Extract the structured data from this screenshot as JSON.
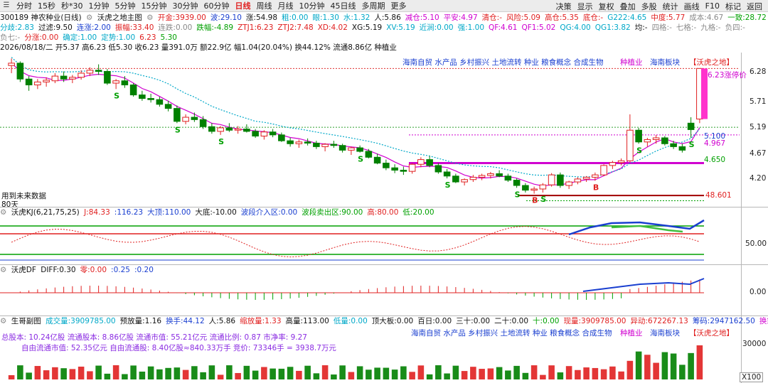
{
  "toolbar": {
    "periods": [
      "分时",
      "15秒",
      "秒*30",
      "1分钟",
      "5分钟",
      "15分钟",
      "30分钟",
      "60分钟",
      "日线",
      "周线",
      "月线",
      "10分钟",
      "45日线",
      "多周期",
      "更多"
    ],
    "right": [
      "决策",
      "显示",
      "复权",
      "叠加",
      "多股",
      "统计",
      "画线",
      "F10",
      "标记",
      "返回"
    ]
  },
  "info_row1": {
    "stock": "300189 神农种业(日线)",
    "indicator": "沃虎之地主图",
    "items": [
      {
        "k": "开金:",
        "v": "3939.00",
        "c": "red"
      },
      {
        "k": "波:",
        "v": "29.10",
        "c": "blue"
      },
      {
        "k": "涨:",
        "v": "54.98",
        "c": "blk"
      },
      {
        "k": "粗:",
        "v": "0.00",
        "c": "cyan"
      },
      {
        "k": "眼:",
        "v": "1.30",
        "c": "cyan"
      },
      {
        "k": "水:",
        "v": "1.32",
        "c": "cyan"
      },
      {
        "k": "人:",
        "v": "5.86",
        "c": "blk"
      },
      {
        "k": "减仓:",
        "v": "5.10",
        "c": "mag"
      },
      {
        "k": "平安:",
        "v": "4.97",
        "c": "mag"
      },
      {
        "k": "清仓:",
        "v": "-",
        "c": "red"
      },
      {
        "k": "风险:",
        "v": "5.09",
        "c": "red"
      },
      {
        "k": "高仓:",
        "v": "5.35",
        "c": "red"
      },
      {
        "k": "底仓:",
        "v": "-",
        "c": "red"
      },
      {
        "k": "G222:",
        "v": "4.65",
        "c": "cyan"
      },
      {
        "k": "中度:",
        "v": "5.77",
        "c": "red"
      },
      {
        "k": "成本:",
        "v": "4.67",
        "c": "gray"
      },
      {
        "k": "一致:",
        "v": "28.72",
        "c": "grn"
      }
    ]
  },
  "info_row2": {
    "items": [
      {
        "k": "分歧:",
        "v": "2.83",
        "c": "cyan"
      },
      {
        "k": "过滤:",
        "v": "9.50",
        "c": "blk"
      },
      {
        "k": "连涨:",
        "v": "2.00",
        "c": "blue"
      },
      {
        "k": "振幅:",
        "v": "33.40",
        "c": "red"
      },
      {
        "k": "连跌:",
        "v": "0.00",
        "c": "gray"
      },
      {
        "k": "跌幅:",
        "v": "-4.89",
        "c": "grn"
      },
      {
        "k": "ZTJ1:",
        "v": "6.23",
        "c": "red"
      },
      {
        "k": "ZTJ2:",
        "v": "7.48",
        "c": "red"
      },
      {
        "k": "XD:",
        "v": "4.02",
        "c": "red"
      },
      {
        "k": "XG:",
        "v": "5.19",
        "c": "blk"
      },
      {
        "k": "XV:",
        "v": "5.19",
        "c": "cyan"
      },
      {
        "k": "近涧:",
        "v": "0.00",
        "c": "cyan"
      },
      {
        "k": "强:",
        "v": "1.00",
        "c": "cyan"
      },
      {
        "k": "QF:",
        "v": "4.61",
        "c": "mag"
      },
      {
        "k": "QF1:",
        "v": "5.02",
        "c": "mag"
      },
      {
        "k": "QG:",
        "v": "4.00",
        "c": "cyan"
      },
      {
        "k": "QG1:",
        "v": "3.82",
        "c": "cyan"
      },
      {
        "k": "均:",
        "v": "-",
        "c": "blk"
      },
      {
        "k": "四格:",
        "v": "-",
        "c": "gray"
      },
      {
        "k": "七格:",
        "v": "-",
        "c": "gray"
      },
      {
        "k": "九格:",
        "v": "-",
        "c": "gray"
      },
      {
        "k": "负四:",
        "v": "-",
        "c": "gray"
      }
    ]
  },
  "info_row3": {
    "items": [
      {
        "k": "负七:",
        "v": "-",
        "c": "gray"
      },
      {
        "k": "分涨:",
        "v": "0.00",
        "c": "red"
      },
      {
        "k": "确定:",
        "v": "1.00",
        "c": "cyan"
      },
      {
        "k": "定势:",
        "v": "1.00",
        "c": "cyan"
      },
      {
        "k": "",
        "v": "6.23",
        "c": "red"
      },
      {
        "k": "",
        "v": "5.30",
        "c": "grn"
      }
    ]
  },
  "bar_info": "2026/08/18/二 开5.37 高6.23 低5.30 收6.23 量391.0万 额22.9亿 幅1.04(20.04%) 换44.12% 流通8.86亿 种植业",
  "sectors": "海南自贸 水产品 乡村振兴 土地流转 种业 粮食概念 合成生物",
  "sector_tags": [
    "种植业",
    "海南板块",
    "【沃虎之地】"
  ],
  "main_chart": {
    "price_axis": [
      "6.28",
      "5.71",
      "5.19",
      "4.67",
      "4.20"
    ],
    "labels": {
      "limit_up": "6.23涨停价",
      "l5100": "5.100",
      "l4967": "4.967",
      "l4650": "4.650",
      "l48601": "48.601",
      "future": "用到未来数据",
      "days": "80天"
    }
  },
  "kj_panel": {
    "title": "沃虎KJ(6,21,75,25)",
    "items": [
      {
        "k": "J:",
        "v": "84.33",
        "c": "red"
      },
      {
        "k": ":",
        "v": "116.23",
        "c": "blue"
      },
      {
        "k": "大顶:",
        "v": "110.00",
        "c": "blue"
      },
      {
        "k": "大底:",
        "v": "-10.00",
        "c": "blk"
      },
      {
        "k": "波段介入区:",
        "v": "0.00",
        "c": "blue"
      },
      {
        "k": "波段卖出区:",
        "v": "90.00",
        "c": "grn"
      },
      {
        "k": "高:",
        "v": "80.00",
        "c": "red"
      },
      {
        "k": "低:",
        "v": "20.00",
        "c": "grn"
      }
    ],
    "axis": "50.00"
  },
  "df_panel": {
    "title": "沃虎DF",
    "items": [
      {
        "k": "DIFF:",
        "v": "0.30",
        "c": "blk"
      },
      {
        "k": "零:",
        "v": "0.00",
        "c": "red"
      },
      {
        "k": ":",
        "v": "0.25",
        "c": "blue"
      },
      {
        "k": ":",
        "v": "0.20",
        "c": "blue"
      }
    ],
    "axis": "0.00"
  },
  "vol_panel": {
    "title": "生哥副图",
    "items": [
      {
        "k": "成交量:",
        "v": "3909785.00",
        "c": "cyan"
      },
      {
        "k": "预放量:",
        "v": "1.16",
        "c": "blk"
      },
      {
        "k": "换手:",
        "v": "44.12",
        "c": "blue"
      },
      {
        "k": "人:",
        "v": "5.86",
        "c": "blk"
      },
      {
        "k": "缩放量:",
        "v": "1.33",
        "c": "red"
      },
      {
        "k": "高量:",
        "v": "113.00",
        "c": "blk"
      },
      {
        "k": "低量:",
        "v": "0.00",
        "c": "cyan"
      },
      {
        "k": "顶大板:",
        "v": "0.00",
        "c": "blk"
      },
      {
        "k": "百日:",
        "v": "0.00",
        "c": "blk"
      },
      {
        "k": "三十:",
        "v": "0.00",
        "c": "blk"
      },
      {
        "k": "二十:",
        "v": "0.00",
        "c": "blk"
      },
      {
        "k": "十:",
        "v": "0.00",
        "c": "grn"
      },
      {
        "k": "现量:",
        "v": "3909785.00",
        "c": "red"
      },
      {
        "k": "异动:",
        "v": "672267.13",
        "c": "red"
      },
      {
        "k": "筹码:",
        "v": "2947162.50",
        "c": "blue"
      },
      {
        "k": "换筹充分:",
        "v": "1",
        "c": "mag"
      }
    ],
    "fund_row1": "总股本:  10.24亿股   流通股本:  8.86亿股    流通市值:  55.21亿元     流通比例:  0.87     市净率:  9.27",
    "fund_row2": "自由流通市值:                         52.35亿元          自由流通股:  8.40亿股≈840.33万手      竞价:  73346手 = 3938.7万元",
    "axis": "30000",
    "zoom": "X100"
  },
  "chart_data": {
    "type": "candlestick",
    "title": "300189 神农种业(日线)",
    "x_end": "2026/08/18",
    "ylim": [
      3.95,
      6.5
    ],
    "candles": [
      [
        6.28,
        6.4,
        6.15,
        6.32
      ],
      [
        6.32,
        6.35,
        6.0,
        6.05
      ],
      [
        6.05,
        6.1,
        5.85,
        5.95
      ],
      [
        5.95,
        6.05,
        5.88,
        6.0
      ],
      [
        6.0,
        6.08,
        5.92,
        6.03
      ],
      [
        6.02,
        6.15,
        5.98,
        6.1
      ],
      [
        6.1,
        6.18,
        6.0,
        6.05
      ],
      [
        6.05,
        6.12,
        5.98,
        6.08
      ],
      [
        6.08,
        6.2,
        6.04,
        6.15
      ],
      [
        6.15,
        6.25,
        6.1,
        6.2
      ],
      [
        6.2,
        6.3,
        6.12,
        6.18
      ],
      [
        6.18,
        6.22,
        5.95,
        5.98
      ],
      [
        5.98,
        6.05,
        5.88,
        6.02
      ],
      [
        6.02,
        6.1,
        5.9,
        5.95
      ],
      [
        5.95,
        5.98,
        5.75,
        5.78
      ],
      [
        5.78,
        5.85,
        5.68,
        5.72
      ],
      [
        5.72,
        5.8,
        5.65,
        5.7
      ],
      [
        5.7,
        5.75,
        5.58,
        5.62
      ],
      [
        5.62,
        5.68,
        5.5,
        5.55
      ],
      [
        5.55,
        5.6,
        5.3,
        5.33
      ],
      [
        5.33,
        5.45,
        5.28,
        5.4
      ],
      [
        5.4,
        5.48,
        5.32,
        5.36
      ],
      [
        5.36,
        5.42,
        5.2,
        5.24
      ],
      [
        5.24,
        5.3,
        5.12,
        5.16
      ],
      [
        5.16,
        5.25,
        5.1,
        5.22
      ],
      [
        5.22,
        5.3,
        5.15,
        5.18
      ],
      [
        5.18,
        5.25,
        5.12,
        5.2
      ],
      [
        5.2,
        5.28,
        5.14,
        5.16
      ],
      [
        5.16,
        5.2,
        5.05,
        5.08
      ],
      [
        5.08,
        5.18,
        5.02,
        5.15
      ],
      [
        5.15,
        5.2,
        5.06,
        5.1
      ],
      [
        5.1,
        5.14,
        4.98,
        5.0
      ],
      [
        5.0,
        5.05,
        4.9,
        4.95
      ],
      [
        4.95,
        5.02,
        4.88,
        4.98
      ],
      [
        4.98,
        5.04,
        4.92,
        4.96
      ],
      [
        4.96,
        5.0,
        4.86,
        4.9
      ],
      [
        4.9,
        4.96,
        4.82,
        4.94
      ],
      [
        4.94,
        5.0,
        4.88,
        4.92
      ],
      [
        4.92,
        4.95,
        4.8,
        4.84
      ],
      [
        4.84,
        4.9,
        4.76,
        4.88
      ],
      [
        4.88,
        4.92,
        4.8,
        4.82
      ],
      [
        4.82,
        4.86,
        4.7,
        4.72
      ],
      [
        4.72,
        4.78,
        4.6,
        4.62
      ],
      [
        4.62,
        4.68,
        4.5,
        4.54
      ],
      [
        4.54,
        4.6,
        4.45,
        4.5
      ],
      [
        4.5,
        4.56,
        4.42,
        4.48
      ],
      [
        4.48,
        4.62,
        4.44,
        4.6
      ],
      [
        4.6,
        4.72,
        4.55,
        4.68
      ],
      [
        4.68,
        4.74,
        4.55,
        4.58
      ],
      [
        4.58,
        4.62,
        4.44,
        4.47
      ],
      [
        4.47,
        4.52,
        4.36,
        4.4
      ],
      [
        4.4,
        4.44,
        4.28,
        4.3
      ],
      [
        4.3,
        4.36,
        4.24,
        4.34
      ],
      [
        4.34,
        4.42,
        4.3,
        4.38
      ],
      [
        4.38,
        4.44,
        4.33,
        4.41
      ],
      [
        4.41,
        4.47,
        4.36,
        4.44
      ],
      [
        4.44,
        4.5,
        4.38,
        4.4
      ],
      [
        4.4,
        4.44,
        4.3,
        4.33
      ],
      [
        4.33,
        4.36,
        4.2,
        4.24
      ],
      [
        4.24,
        4.28,
        4.12,
        4.16
      ],
      [
        4.16,
        4.22,
        4.1,
        4.18
      ],
      [
        4.18,
        4.28,
        4.12,
        4.25
      ],
      [
        4.25,
        4.45,
        4.22,
        4.42
      ],
      [
        4.42,
        4.46,
        4.2,
        4.24
      ],
      [
        4.24,
        4.32,
        4.18,
        4.3
      ],
      [
        4.3,
        4.38,
        4.26,
        4.35
      ],
      [
        4.35,
        4.4,
        4.3,
        4.38
      ],
      [
        4.38,
        4.46,
        4.32,
        4.42
      ],
      [
        4.42,
        4.6,
        4.4,
        4.58
      ],
      [
        4.58,
        4.66,
        4.52,
        4.63
      ],
      [
        4.63,
        4.7,
        4.58,
        4.66
      ],
      [
        4.66,
        5.45,
        4.64,
        5.18
      ],
      [
        5.18,
        5.22,
        4.95,
        4.98
      ],
      [
        4.98,
        5.05,
        4.9,
        5.02
      ],
      [
        5.02,
        5.1,
        4.95,
        5.05
      ],
      [
        5.05,
        5.08,
        4.92,
        4.95
      ],
      [
        4.95,
        5.0,
        4.86,
        4.9
      ],
      [
        4.9,
        4.95,
        4.8,
        4.84
      ],
      [
        5.3,
        5.4,
        5.05,
        5.19
      ],
      [
        5.37,
        6.23,
        5.3,
        6.23
      ]
    ]
  }
}
